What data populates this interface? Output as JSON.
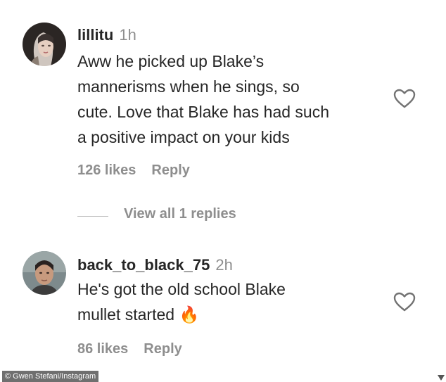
{
  "comments": [
    {
      "username": "lillitu",
      "time": "1h",
      "text_lines": [
        "Aww he picked up Blake’s",
        "mannerisms when he sings, so",
        "cute. Love that Blake has had such",
        "a positive impact on your kids"
      ],
      "likes": "126 likes",
      "reply": "Reply",
      "avatar_icon": "avatar-photo-dark-hair",
      "like_icon": "heart-outline-icon"
    },
    {
      "username": "back_to_black_75",
      "time": "2h",
      "text_lines": [
        "He's got the old school Blake",
        "mullet started"
      ],
      "emoji": "🔥",
      "likes": "86 likes",
      "reply": "Reply",
      "avatar_icon": "avatar-photo-short-hair",
      "like_icon": "heart-outline-icon"
    }
  ],
  "view_replies": "View all 1 replies",
  "credit": "© Gwen Stefani/Instagram",
  "colors": {
    "text": "#262626",
    "muted": "#8e8e8e",
    "fire": "#f7931e"
  }
}
